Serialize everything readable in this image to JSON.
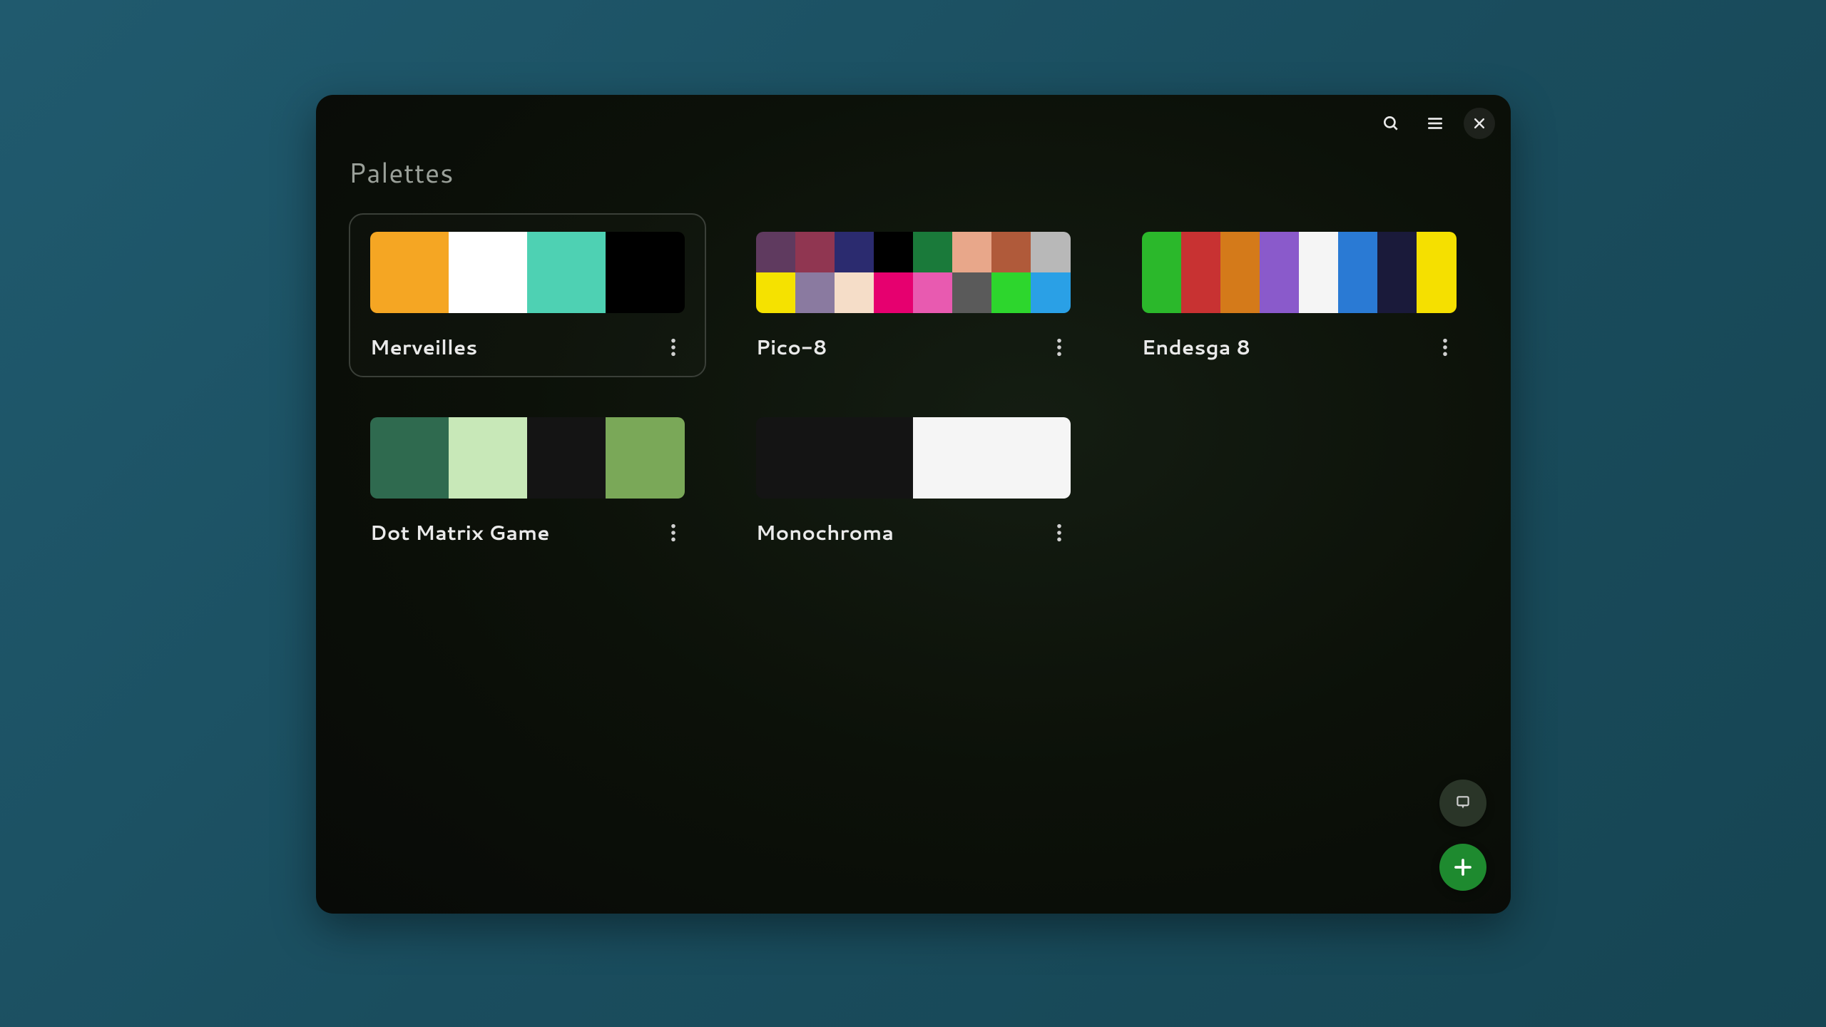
{
  "header": {
    "title": "Palettes"
  },
  "icons": {
    "search": "search-icon",
    "menu": "menu-icon",
    "close": "close-icon",
    "picker": "color-picker-icon",
    "add": "plus-icon",
    "more": "more-vert-icon"
  },
  "palettes": [
    {
      "name": "Merveilles",
      "selected": true,
      "rows": [
        [
          "#f5a623",
          "#ffffff",
          "#4ed1b3",
          "#000000"
        ]
      ]
    },
    {
      "name": "Pico-8",
      "selected": false,
      "rows": [
        [
          "#5f3a5f",
          "#903651",
          "#2b2b6f",
          "#000000",
          "#1a7a3a",
          "#e8a78a",
          "#b05a3a",
          "#b8b8b8"
        ],
        [
          "#f5e200",
          "#8a7aa0",
          "#f5ddc8",
          "#e6006f",
          "#e85ab0",
          "#5a5a5a",
          "#2dd62d",
          "#2aa0e6"
        ]
      ]
    },
    {
      "name": "Endesga 8",
      "selected": false,
      "rows": [
        [
          "#2bb82b",
          "#c83232",
          "#d47a1a",
          "#8a5acb",
          "#f5f5f5",
          "#2a7ad4",
          "#1a1a3a",
          "#f5e000"
        ]
      ]
    },
    {
      "name": "Dot Matrix Game",
      "selected": false,
      "rows": [
        [
          "#2f6a4f",
          "#c8e8b8",
          "#141414",
          "#7aa858"
        ]
      ]
    },
    {
      "name": "Monochroma",
      "selected": false,
      "rows": [
        [
          "#141414",
          "#f5f5f5"
        ]
      ]
    }
  ],
  "colors": {
    "accent": "#1e8a2f",
    "window_bg": "#0c1109",
    "desktop_bg": "#205a6e"
  }
}
